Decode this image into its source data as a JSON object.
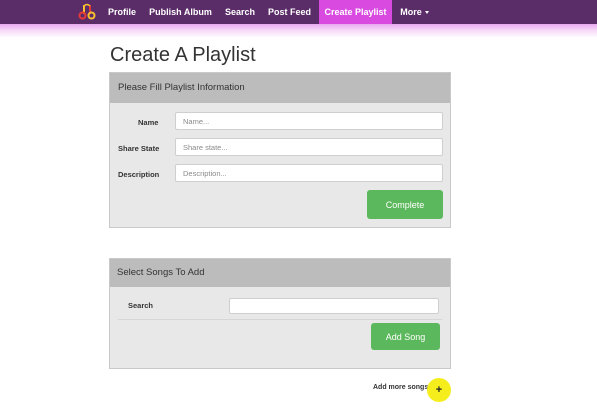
{
  "nav": {
    "items": [
      {
        "label": "Profile"
      },
      {
        "label": "Publish Album"
      },
      {
        "label": "Search"
      },
      {
        "label": "Post Feed"
      },
      {
        "label": "Create Playlist",
        "active": true
      },
      {
        "label": "More"
      }
    ],
    "logo_icon": "music-note-logo-icon",
    "colors": {
      "bar": "#5b2d68",
      "active": "#d94ae0",
      "logo_a": "#e53935",
      "logo_b": "#fbc02d"
    }
  },
  "page": {
    "title": "Create A Playlist"
  },
  "playlist_form": {
    "heading": "Please Fill Playlist Information",
    "name": {
      "label": "Name",
      "placeholder": "Name...",
      "value": ""
    },
    "share_state": {
      "label": "Share State",
      "placeholder": "Share state...",
      "value": ""
    },
    "description": {
      "label": "Description",
      "placeholder": "Description...",
      "value": ""
    },
    "submit_label": "Complete"
  },
  "songs_form": {
    "heading": "Select Songs To Add",
    "search": {
      "label": "Search",
      "placeholder": "",
      "value": ""
    },
    "add_label": "Add Song"
  },
  "add_more": {
    "text": "Add more songs",
    "button_label": "+",
    "button_color": "#f5ee1c"
  },
  "accent": {
    "green": "#5cb85c"
  }
}
